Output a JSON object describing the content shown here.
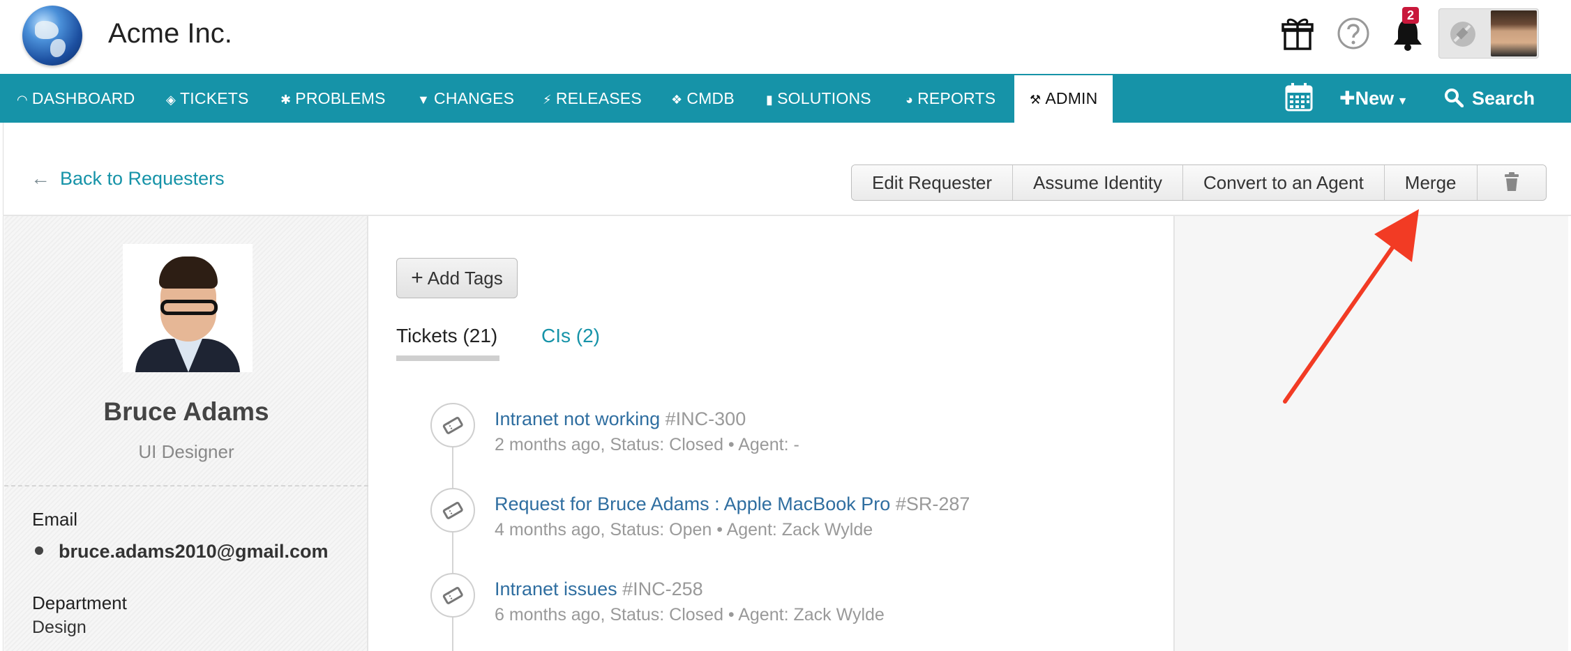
{
  "header": {
    "app_title": "Acme Inc.",
    "icons": [
      "gift-icon",
      "help-icon",
      "bell-icon",
      "satellite-icon"
    ],
    "notification_count": "2"
  },
  "nav": {
    "items": [
      {
        "label": "DASHBOARD",
        "icon": "dashboard-icon"
      },
      {
        "label": "TICKETS",
        "icon": "ticket-icon"
      },
      {
        "label": "PROBLEMS",
        "icon": "bug-icon"
      },
      {
        "label": "CHANGES",
        "icon": "changes-icon"
      },
      {
        "label": "RELEASES",
        "icon": "lightning-icon"
      },
      {
        "label": "CMDB",
        "icon": "cube-icon"
      },
      {
        "label": "SOLUTIONS",
        "icon": "book-icon"
      },
      {
        "label": "REPORTS",
        "icon": "pie-icon"
      },
      {
        "label": "ADMIN",
        "icon": "tools-icon"
      }
    ],
    "active": "ADMIN",
    "new_label": "New",
    "search_label": "Search"
  },
  "toolbar": {
    "back_label": "Back to Requesters",
    "buttons": [
      "Edit Requester",
      "Assume Identity",
      "Convert to an Agent",
      "Merge"
    ],
    "delete_icon": "trash-icon"
  },
  "profile": {
    "name": "Bruce Adams",
    "title": "UI Designer",
    "email_label": "Email",
    "email": "bruce.adams2010@gmail.com",
    "department_label": "Department",
    "department": "Design"
  },
  "main": {
    "add_tags_label": "Add Tags",
    "tabs": [
      {
        "label": "Tickets (21)",
        "active": true
      },
      {
        "label": "CIs (2)",
        "active": false
      }
    ],
    "tickets": [
      {
        "title": "Intranet not working",
        "id": "#INC-300",
        "meta": "2 months ago,  Status: Closed  •  Agent: -"
      },
      {
        "title": "Request for Bruce Adams : Apple MacBook Pro",
        "id": "#SR-287",
        "meta": "4 months ago,  Status: Open  •  Agent: Zack Wylde"
      },
      {
        "title": "Intranet issues",
        "id": "#INC-258",
        "meta": "6 months ago,  Status: Closed  •  Agent: Zack Wylde"
      }
    ]
  },
  "colors": {
    "nav_bg": "#1693a8",
    "link": "#1693a8",
    "ticket_link": "#2f6ea0",
    "badge": "#c9183b",
    "annotation_arrow": "#f23b24"
  }
}
